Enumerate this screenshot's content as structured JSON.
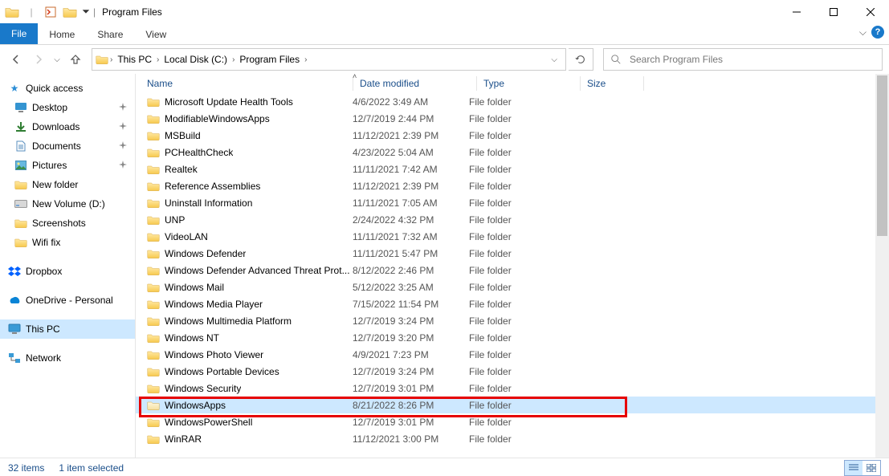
{
  "window": {
    "title": "Program Files"
  },
  "ribbon": {
    "file": "File",
    "home": "Home",
    "share": "Share",
    "view": "View"
  },
  "breadcrumb": [
    "This PC",
    "Local Disk (C:)",
    "Program Files"
  ],
  "search": {
    "placeholder": "Search Program Files"
  },
  "columns": {
    "name": "Name",
    "date": "Date modified",
    "type": "Type",
    "size": "Size"
  },
  "sidebar": {
    "quick_access": "Quick access",
    "quick_items": [
      {
        "label": "Desktop",
        "icon": "desktop",
        "pinned": true
      },
      {
        "label": "Downloads",
        "icon": "downloads",
        "pinned": true
      },
      {
        "label": "Documents",
        "icon": "documents",
        "pinned": true
      },
      {
        "label": "Pictures",
        "icon": "pictures",
        "pinned": true
      },
      {
        "label": "New folder",
        "icon": "folder",
        "pinned": false
      },
      {
        "label": "New Volume (D:)",
        "icon": "drive",
        "pinned": false
      },
      {
        "label": "Screenshots",
        "icon": "folder",
        "pinned": false
      },
      {
        "label": "Wifi fix",
        "icon": "folder",
        "pinned": false
      }
    ],
    "dropbox": "Dropbox",
    "onedrive": "OneDrive - Personal",
    "this_pc": "This PC",
    "network": "Network"
  },
  "files": [
    {
      "name": "Microsoft Update Health Tools",
      "date": "4/6/2022 3:49 AM",
      "type": "File folder"
    },
    {
      "name": "ModifiableWindowsApps",
      "date": "12/7/2019 2:44 PM",
      "type": "File folder"
    },
    {
      "name": "MSBuild",
      "date": "11/12/2021 2:39 PM",
      "type": "File folder"
    },
    {
      "name": "PCHealthCheck",
      "date": "4/23/2022 5:04 AM",
      "type": "File folder"
    },
    {
      "name": "Realtek",
      "date": "11/11/2021 7:42 AM",
      "type": "File folder"
    },
    {
      "name": "Reference Assemblies",
      "date": "11/12/2021 2:39 PM",
      "type": "File folder"
    },
    {
      "name": "Uninstall Information",
      "date": "11/11/2021 7:05 AM",
      "type": "File folder"
    },
    {
      "name": "UNP",
      "date": "2/24/2022 4:32 PM",
      "type": "File folder"
    },
    {
      "name": "VideoLAN",
      "date": "11/11/2021 7:32 AM",
      "type": "File folder"
    },
    {
      "name": "Windows Defender",
      "date": "11/11/2021 5:47 PM",
      "type": "File folder"
    },
    {
      "name": "Windows Defender Advanced Threat Prot...",
      "date": "8/12/2022 2:46 PM",
      "type": "File folder"
    },
    {
      "name": "Windows Mail",
      "date": "5/12/2022 3:25 AM",
      "type": "File folder"
    },
    {
      "name": "Windows Media Player",
      "date": "7/15/2022 11:54 PM",
      "type": "File folder"
    },
    {
      "name": "Windows Multimedia Platform",
      "date": "12/7/2019 3:24 PM",
      "type": "File folder"
    },
    {
      "name": "Windows NT",
      "date": "12/7/2019 3:20 PM",
      "type": "File folder"
    },
    {
      "name": "Windows Photo Viewer",
      "date": "4/9/2021 7:23 PM",
      "type": "File folder"
    },
    {
      "name": "Windows Portable Devices",
      "date": "12/7/2019 3:24 PM",
      "type": "File folder"
    },
    {
      "name": "Windows Security",
      "date": "12/7/2019 3:01 PM",
      "type": "File folder"
    },
    {
      "name": "WindowsApps",
      "date": "8/21/2022 8:26 PM",
      "type": "File folder",
      "selected": true,
      "faded": true
    },
    {
      "name": "WindowsPowerShell",
      "date": "12/7/2019 3:01 PM",
      "type": "File folder"
    },
    {
      "name": "WinRAR",
      "date": "11/12/2021 3:00 PM",
      "type": "File folder"
    }
  ],
  "status": {
    "items": "32 items",
    "selected": "1 item selected"
  }
}
